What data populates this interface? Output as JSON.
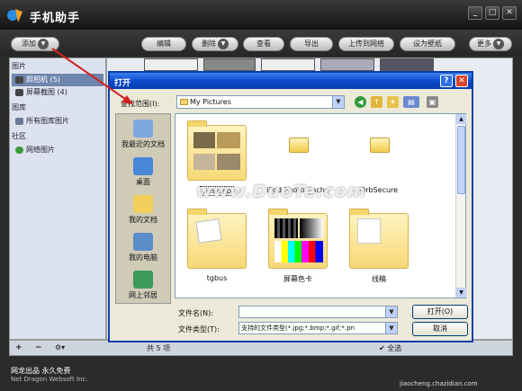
{
  "app": {
    "title": "手机助手",
    "window_buttons": [
      "_",
      "□",
      "✕"
    ],
    "footer_line1": "网龙出品 永久免费",
    "footer_line2": "Net Dragon Websoft Inc."
  },
  "toolbar": {
    "add": "添加",
    "edit": "编辑",
    "delete": "删除",
    "view": "查看",
    "export": "导出",
    "upload": "上传到网络",
    "set_wallpaper": "设为壁纸",
    "more": "更多"
  },
  "sidebar": {
    "section_photos": "图片",
    "camera": "照相机 (5)",
    "screenshots": "屏幕截图 (4)",
    "section_library": "图库",
    "all_library": "所有图库图片",
    "section_community": "社区",
    "web_photos": "网络图片"
  },
  "bottom_bar": {
    "add": "+",
    "remove": "−",
    "settings": "⚙▾",
    "count_prefix": "共",
    "count": "5",
    "count_suffix": "项",
    "select_all": "全选"
  },
  "dialog": {
    "title": "打开",
    "help": "?",
    "close": "✕",
    "lookin_label": "查找范围(I):",
    "lookin_value": "My Pictures",
    "places": [
      "我最近的文档",
      "桌面",
      "我的文档",
      "我的电脑",
      "网上邻居"
    ],
    "items": [
      {
        "name": "desktop",
        "kind": "photo-folder"
      },
      {
        "name": "iPod Photo Cache",
        "kind": "folder"
      },
      {
        "name": "OrbSecure",
        "kind": "folder"
      },
      {
        "name": "tgbus",
        "kind": "photo-folder"
      },
      {
        "name": "屏幕色卡",
        "kind": "photo-folder"
      },
      {
        "name": "线稿",
        "kind": "photo-folder"
      }
    ],
    "filename_label": "文件名(N):",
    "filename_value": "",
    "filetype_label": "文件类型(T):",
    "filetype_value": "支持的文件类型(*.jpg;*.bmp;*.gif;*.pn",
    "open_button": "打开(O)",
    "cancel_button": "取消"
  },
  "watermark": "www.DuoTe.com",
  "corner_text": "jiaocheng.chazidian.com",
  "colors": {
    "dialog_title": "#0a47c8",
    "selected_item": "#6e85ad",
    "folder": "#f7d876",
    "annotation_arrow": "#d42020"
  }
}
